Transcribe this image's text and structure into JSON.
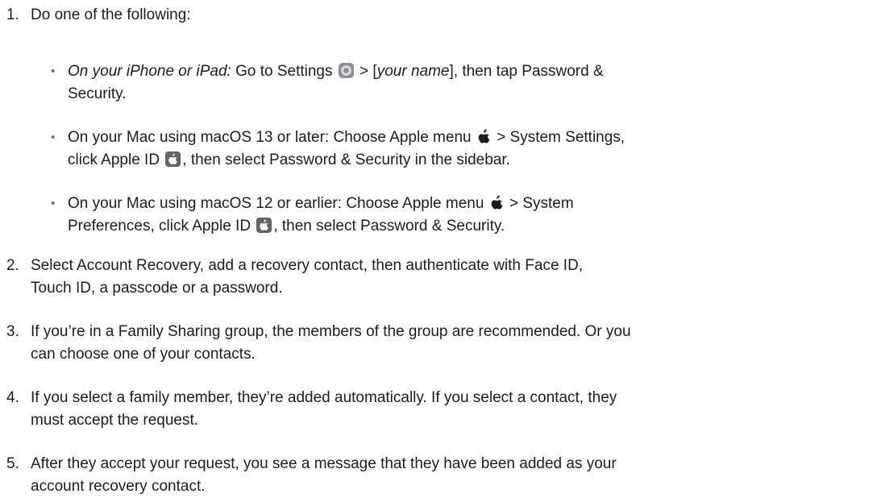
{
  "steps": [
    {
      "number": "1.",
      "text": "Do one of the following:",
      "bullets": [
        {
          "marker": "•",
          "lead": "On your iPhone or iPad:",
          "part1": " Go to Settings ",
          "icon": "settings-icon",
          "part2": " > [",
          "italic": "your name",
          "part3": "], then tap Password &",
          "line2": "Security."
        },
        {
          "marker": "•",
          "part1": "On your Mac using macOS 13 or later: Choose Apple menu ",
          "icon": "apple-logo-icon",
          "part2": " > System Settings,",
          "line2a": "click Apple ID ",
          "icon2": "apple-id-icon",
          "line2b": ", then select Password & Security in the sidebar."
        },
        {
          "marker": "•",
          "part1": "On your Mac using macOS 12 or earlier: Choose Apple menu ",
          "icon": "apple-logo-icon",
          "part2": " > System",
          "line2a": "Preferences, click Apple ID ",
          "icon2": "apple-id-icon",
          "line2b": ", then select Password & Security."
        }
      ]
    },
    {
      "number": "2.",
      "line1": "Select Account Recovery, add a recovery contact, then authenticate with Face ID,",
      "line2": "Touch ID, a passcode or a password."
    },
    {
      "number": "3.",
      "line1": "If you’re in a Family Sharing group, the members of the group are recommended. Or you",
      "line2": "can choose one of your contacts."
    },
    {
      "number": "4.",
      "line1": "If you select a family member, they’re added automatically. If you select a contact, they",
      "line2": "must accept the request."
    },
    {
      "number": "5.",
      "line1": "After they accept your request, you see a message that they have been added as your",
      "line2": "account recovery contact."
    }
  ]
}
